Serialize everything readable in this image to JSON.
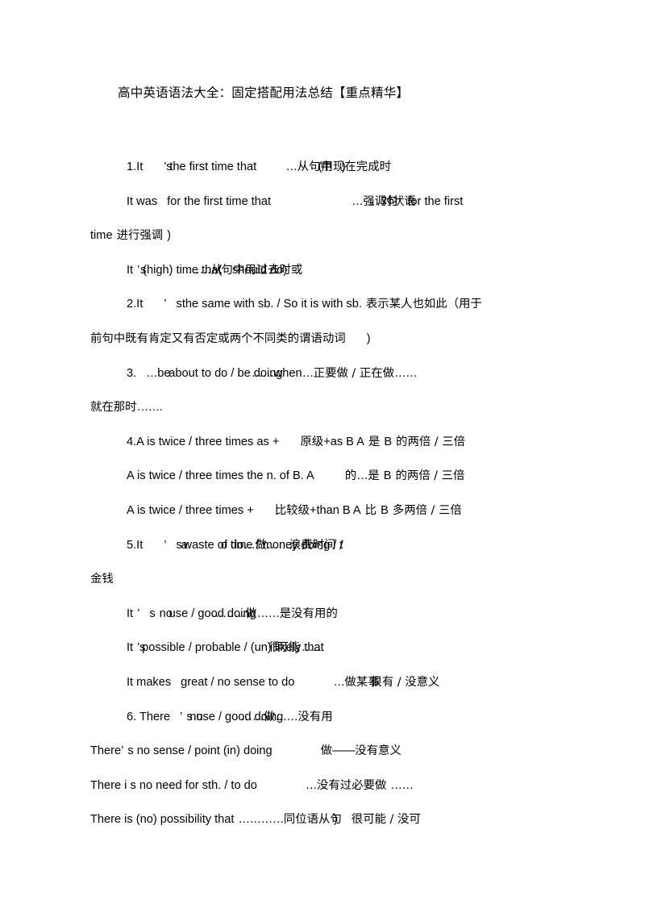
{
  "document": {
    "title": "高中英语语法大全：固定搭配用法总结【重点精华】",
    "background_color": "#ffffff",
    "text_color": "#000000"
  },
  "lines": {
    "l1_a": "1.It",
    "l1_b": "’",
    "l1_c": "s",
    "l1_d": "the first time that",
    "l1_e": "…",
    "l1_f": "从句中",
    "l1_g": "(",
    "l1_h": "用现在完成时",
    "l1_i": ")",
    "l2_a": "It was",
    "l2_b": "for the first time that",
    "l2_c": "…",
    "l2_d": "强调句",
    "l2_e": "，对状语",
    "l2_f": "for the first",
    "l3_a": "time",
    "l3_b": "进行强调",
    "l3_c": ")",
    "l4_a": "It",
    "l4_b": "’",
    "l4_c": "s",
    "l4_d": "(high) time that",
    "l4_e": "……",
    "l4_f": "从",
    "l4_g": "(",
    "l4_h": "句中用过去时或",
    "l4_i": "should do)",
    "l5_a": "2.It",
    "l5_b": "’",
    "l5_c": "s",
    "l5_d": "the same with sb. / So it is with sb.",
    "l5_e": "表示某人也如此（用于",
    "l6_a": "前句中既有肯定又有否定或两个不同类的谓语动词",
    "l6_b": ")",
    "l7_a": "3.",
    "l7_b": "…",
    "l7_c": "be",
    "l7_d": "about to do / be doing",
    "l7_e": "……",
    "l7_f": "when",
    "l7_g": "…",
    "l7_h": "正要做 / 正在做",
    "l7_i": "……",
    "l8_a": "就在那时",
    "l8_b": "…….",
    "l9_a": "4.A is twice / three times as +",
    "l9_b": "原级",
    "l9_c": "+as B A",
    "l9_d": "是",
    "l9_e": "B",
    "l9_f": "的两倍 / 三倍",
    "l10_a": "A is twice / three times the n. of B. A",
    "l10_b": "的",
    "l10_c": "…",
    "l10_d": "是",
    "l10_e": "B",
    "l10_f": "的两倍 / 三倍",
    "l11_a": "A is twice / three times +",
    "l11_b": "比较级",
    "l11_c": "+than B A",
    "l11_d": "比",
    "l11_e": "B",
    "l11_f": "多两倍 / 三倍",
    "l12_a": "5.It",
    "l12_b": "’",
    "l12_c": "s",
    "l12_d": "a",
    "l12_e": "waste of time / money doing / t",
    "l12_f": "o do",
    "l12_g": "…",
    "l12_h": "做",
    "l12_i": "……",
    "l12_j": "浪费时间 /",
    "l13_a": "金钱",
    "l14_a": "It",
    "l14_b": "’",
    "l14_c": "s",
    "l14_d": "no",
    "l14_e": "use / good doing",
    "l14_f": "………",
    "l14_g": "做",
    "l14_h": "……",
    "l14_i": "是没有用的",
    "l15_a": "It",
    "l15_b": "’",
    "l15_c": "s",
    "l15_d": "possible / probable / (un) likely that",
    "l15_e": "很",
    "l15_f": "可能",
    "l15_g": "……",
    "l16_a": "It makes",
    "l16_b": "great / no sense to do",
    "l16_c": "…",
    "l16_d": "做某事",
    "l16_e": "很有 / 没意义",
    "l17_a": "6. There",
    "l17_b": "’",
    "l17_c": "s",
    "l17_d": "no",
    "l17_e": "use / good doing",
    "l17_f": "……",
    "l17_g": "做",
    "l17_h": "……",
    "l17_i": "没有用",
    "l18_a": "There",
    "l18_b": "’",
    "l18_c": "s no sense / point (in) doing",
    "l18_d": "做",
    "l18_e": "——",
    "l18_f": "没有意义",
    "l19_a": "There i s no need for sth. / to do",
    "l19_b": "…",
    "l19_c": "没有过必要做",
    "l19_d": "……",
    "l20_a": "There  is  (no)  possibility  that",
    "l20_b": "…………",
    "l20_c": "同位语从句",
    "l20_d": ")",
    "l20_e": "很可能 / 没可"
  }
}
